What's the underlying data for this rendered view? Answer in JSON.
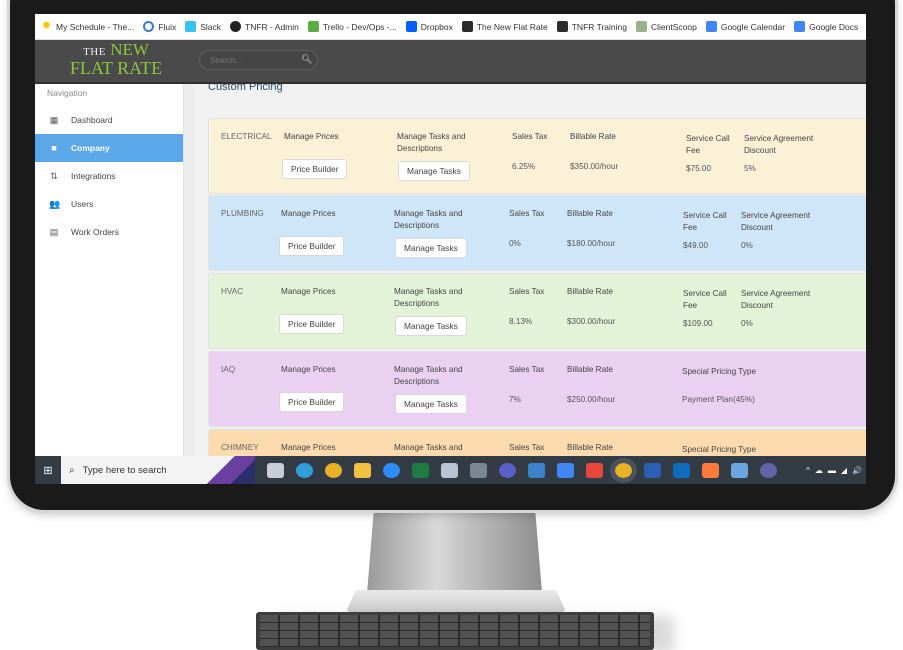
{
  "bookmarks": [
    {
      "label": "My Schedule - The...",
      "icon": "sun-icon",
      "color": "#f5c400"
    },
    {
      "label": "Fluix",
      "icon": "fluix-ring-icon",
      "color": "#3a7bd5"
    },
    {
      "label": "Slack",
      "icon": "slack-icon",
      "color": "#36c5f0"
    },
    {
      "label": "TNFR - Admin",
      "icon": "tnfr-badge-icon",
      "color": "#222222"
    },
    {
      "label": "Trello - Dev/Ops -...",
      "icon": "trello-icon",
      "color": "#5aac44"
    },
    {
      "label": "Dropbox",
      "icon": "dropbox-icon",
      "color": "#0061fe"
    },
    {
      "label": "The New Flat Rate",
      "icon": "tnfr-logo-icon",
      "color": "#2b2b2b"
    },
    {
      "label": "TNFR Training",
      "icon": "tnfr-logo-icon",
      "color": "#2b2b2b"
    },
    {
      "label": "ClientScoop",
      "icon": "tnfr-light-icon",
      "color": "#9bb08c"
    },
    {
      "label": "Google Calendar",
      "icon": "google-calendar-icon",
      "color": "#4285f4"
    },
    {
      "label": "Google Docs",
      "icon": "google-docs-icon",
      "color": "#4285f4"
    }
  ],
  "header": {
    "logo_the": "THE",
    "logo_new": "NEW",
    "logo_line2": "FLAT RATE",
    "search_placeholder": "Search..."
  },
  "sidebar": {
    "title": "Navigation",
    "items": [
      {
        "label": "Dashboard",
        "icon": "dashboard-icon",
        "glyph": "▦",
        "active": false
      },
      {
        "label": "Company",
        "icon": "briefcase-icon",
        "glyph": "■",
        "active": true
      },
      {
        "label": "Integrations",
        "icon": "arrows-icon",
        "glyph": "⇅",
        "active": false
      },
      {
        "label": "Users",
        "icon": "users-icon",
        "glyph": "👥",
        "active": false
      },
      {
        "label": "Work Orders",
        "icon": "work-orders-icon",
        "glyph": "▤",
        "active": false
      }
    ]
  },
  "main": {
    "title": "Custom Pricing",
    "labels": {
      "manage_prices": "Manage Prices",
      "manage_tasks_header": "Manage Tasks and Descriptions",
      "sales_tax": "Sales Tax",
      "billable_rate": "Billable Rate",
      "service_call_fee": "Service Call Fee",
      "service_agreement_discount": "Service Agreement Discount",
      "special_pricing_type": "Special Pricing Type",
      "price_builder_btn": "Price Builder",
      "manage_tasks_btn": "Manage Tasks"
    },
    "departments": [
      {
        "name": "ELECTRICAL",
        "bg": "#fbf1d6",
        "sales_tax": "6.25%",
        "billable_rate": "$350.00/hour",
        "service_call_fee": "$75.00",
        "service_agreement_discount": "5%",
        "type": "standard"
      },
      {
        "name": "PLUMBING",
        "bg": "#cfe6f8",
        "sales_tax": "0%",
        "billable_rate": "$180.00/hour",
        "service_call_fee": "$49.00",
        "service_agreement_discount": "0%",
        "type": "standard"
      },
      {
        "name": "HVAC",
        "bg": "#e2f3d8",
        "sales_tax": "8.13%",
        "billable_rate": "$300.00/hour",
        "service_call_fee": "$109.00",
        "service_agreement_discount": "0%",
        "type": "standard"
      },
      {
        "name": "IAQ",
        "bg": "#ead0f1",
        "sales_tax": "7%",
        "billable_rate": "$250.00/hour",
        "special_pricing_type": "Payment Plan(45%)",
        "type": "special"
      },
      {
        "name": "CHIMNEY",
        "bg": "#fcdcae",
        "sales_tax": "",
        "billable_rate": "",
        "special_pricing_type": "",
        "type": "special"
      }
    ]
  },
  "taskbar": {
    "search_placeholder": "Type here to search",
    "apps": [
      {
        "name": "task-view-icon",
        "color": "#c9ced6"
      },
      {
        "name": "edge-icon",
        "color": "#2f9fd8"
      },
      {
        "name": "chrome-icon",
        "color": "#e9b224"
      },
      {
        "name": "file-explorer-icon",
        "color": "#f2c045"
      },
      {
        "name": "zoom-icon",
        "color": "#2d8cff"
      },
      {
        "name": "excel-icon",
        "color": "#1f7a44"
      },
      {
        "name": "snipping-icon",
        "color": "#b8c4d6"
      },
      {
        "name": "calculator-icon",
        "color": "#7c8794"
      },
      {
        "name": "teams-icon",
        "color": "#5b5fc7"
      },
      {
        "name": "photos-icon",
        "color": "#3c83c9"
      },
      {
        "name": "google-calendar-icon",
        "color": "#4285f4"
      },
      {
        "name": "gmail-icon",
        "color": "#e8453c"
      },
      {
        "name": "chrome-active-icon",
        "color": "#e9b224"
      },
      {
        "name": "word-icon",
        "color": "#2b5fb4"
      },
      {
        "name": "outlook-icon",
        "color": "#0f6cbd"
      },
      {
        "name": "hubspot-icon",
        "color": "#ff7a3d"
      },
      {
        "name": "paint-icon",
        "color": "#6aa6e0"
      },
      {
        "name": "teams-classic-icon",
        "color": "#6264a7"
      }
    ],
    "tray": [
      "^",
      "☁",
      "▬",
      "◢",
      "🔊"
    ]
  }
}
